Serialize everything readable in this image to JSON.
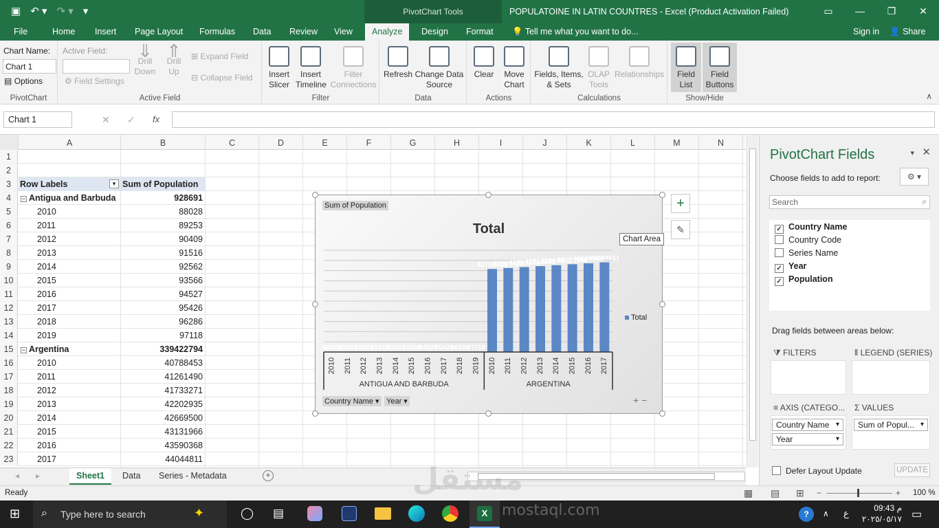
{
  "app": {
    "window_title": "POPULATOINE IN LATIN COUNTRES - Excel (Product Activation Failed)",
    "context_tab_header": "PivotChart Tools",
    "menu_tabs": [
      "File",
      "Home",
      "Insert",
      "Page Layout",
      "Formulas",
      "Data",
      "Review",
      "View",
      "Analyze",
      "Design",
      "Format"
    ],
    "active_tab": "Analyze",
    "tell_me": "Tell me what you want to do...",
    "sign_in": "Sign in",
    "share": "Share"
  },
  "ribbon": {
    "pivotchart": {
      "chart_name_label": "Chart Name:",
      "chart_name_value": "Chart 1",
      "options": "Options",
      "group": "PivotChart"
    },
    "active_field": {
      "label": "Active Field:",
      "field_settings": "Field Settings",
      "drill_down": "Drill Down",
      "drill_up": "Drill Up",
      "expand": "Expand Field",
      "collapse": "Collapse Field",
      "group": "Active Field"
    },
    "filter": {
      "insert_slicer": "Insert Slicer",
      "insert_timeline": "Insert Timeline",
      "filter_connections": "Filter Connections",
      "group": "Filter"
    },
    "data": {
      "refresh": "Refresh",
      "change_data_source": "Change Data Source",
      "group": "Data"
    },
    "actions": {
      "clear": "Clear",
      "move_chart": "Move Chart",
      "group": "Actions"
    },
    "calculations": {
      "fields_items_sets": "Fields, Items, & Sets",
      "olap_tools": "OLAP Tools",
      "relationships": "Relationships",
      "group": "Calculations"
    },
    "show_hide": {
      "field_list": "Field List",
      "field_buttons": "Field Buttons",
      "group": "Show/Hide"
    }
  },
  "formula_bar": {
    "name_box": "Chart 1",
    "formula": ""
  },
  "grid": {
    "columns": [
      "A",
      "B",
      "C",
      "D",
      "E",
      "F",
      "G",
      "H",
      "I",
      "J",
      "K",
      "L",
      "M",
      "N"
    ],
    "rows": [
      {
        "n": "1",
        "a": "",
        "b": ""
      },
      {
        "n": "2",
        "a": "",
        "b": ""
      },
      {
        "n": "3",
        "a": "Row Labels",
        "b": "Sum of Population",
        "type": "header"
      },
      {
        "n": "4",
        "a": "Antigua and Barbuda",
        "b": "928691",
        "type": "group"
      },
      {
        "n": "5",
        "a": "2010",
        "b": "88028"
      },
      {
        "n": "6",
        "a": "2011",
        "b": "89253"
      },
      {
        "n": "7",
        "a": "2012",
        "b": "90409"
      },
      {
        "n": "8",
        "a": "2013",
        "b": "91516"
      },
      {
        "n": "9",
        "a": "2014",
        "b": "92562"
      },
      {
        "n": "10",
        "a": "2015",
        "b": "93566"
      },
      {
        "n": "11",
        "a": "2016",
        "b": "94527"
      },
      {
        "n": "12",
        "a": "2017",
        "b": "95426"
      },
      {
        "n": "13",
        "a": "2018",
        "b": "96286"
      },
      {
        "n": "14",
        "a": "2019",
        "b": "97118"
      },
      {
        "n": "15",
        "a": "Argentina",
        "b": "339422794",
        "type": "group"
      },
      {
        "n": "16",
        "a": "2010",
        "b": "40788453"
      },
      {
        "n": "17",
        "a": "2011",
        "b": "41261490"
      },
      {
        "n": "18",
        "a": "2012",
        "b": "41733271"
      },
      {
        "n": "19",
        "a": "2013",
        "b": "42202935"
      },
      {
        "n": "20",
        "a": "2014",
        "b": "42669500"
      },
      {
        "n": "21",
        "a": "2015",
        "b": "43131966"
      },
      {
        "n": "22",
        "a": "2016",
        "b": "43590368"
      },
      {
        "n": "23",
        "a": "2017",
        "b": "44044811"
      }
    ]
  },
  "chart_data": {
    "type": "bar",
    "title": "Total",
    "value_field_button": "Sum of Population",
    "legend": {
      "entries": [
        "Total"
      ],
      "position": "right"
    },
    "series": [
      {
        "name": "Total",
        "color": "#5b87c5"
      }
    ],
    "groups": [
      {
        "name": "ANTIGUA AND BARBUDA",
        "categories": [
          "2010",
          "2011",
          "2012",
          "2013",
          "2014",
          "2015",
          "2016",
          "2017",
          "2018",
          "2019"
        ],
        "values": [
          88028,
          89253,
          90409,
          91516,
          92562,
          93566,
          94527,
          95426,
          96286,
          97118
        ]
      },
      {
        "name": "ARGENTINA",
        "categories": [
          "2010",
          "2011",
          "2012",
          "2013",
          "2014",
          "2015",
          "2016",
          "2017"
        ],
        "values": [
          40788453,
          41261490,
          41733271,
          42202935,
          42669500,
          43131966,
          43590368,
          44044811
        ]
      }
    ],
    "axis_field_buttons": [
      "Country Name",
      "Year"
    ],
    "grid": true,
    "tooltip": "Chart Area"
  },
  "sheet_tabs": [
    "Sheet1",
    "Data",
    "Series - Metadata"
  ],
  "active_sheet": "Sheet1",
  "status": {
    "ready": "Ready",
    "zoom": "100 %"
  },
  "pane": {
    "title": "PivotChart Fields",
    "subtitle": "Choose fields to add to report:",
    "search_placeholder": "Search",
    "fields": [
      {
        "name": "Country Name",
        "checked": true
      },
      {
        "name": "Country Code",
        "checked": false
      },
      {
        "name": "Series Name",
        "checked": false
      },
      {
        "name": "Year",
        "checked": true
      },
      {
        "name": "Population",
        "checked": true
      }
    ],
    "drag_label": "Drag fields between areas below:",
    "filters": "FILTERS",
    "legend_series": "LEGEND (SERIES)",
    "axis": "AXIS (CATEGO...",
    "values": "VALUES",
    "axis_items": [
      "Country Name",
      "Year"
    ],
    "values_items": [
      "Sum of Popul..."
    ],
    "defer": "Defer Layout Update",
    "update": "UPDATE"
  },
  "taskbar": {
    "search": "Type here to search",
    "time": "09:43 م",
    "date": "٢٠٢٥/٠٥/١٧",
    "lang": "ع"
  },
  "watermark": {
    "line1": "مستقل",
    "line2": "mostaql.com"
  }
}
